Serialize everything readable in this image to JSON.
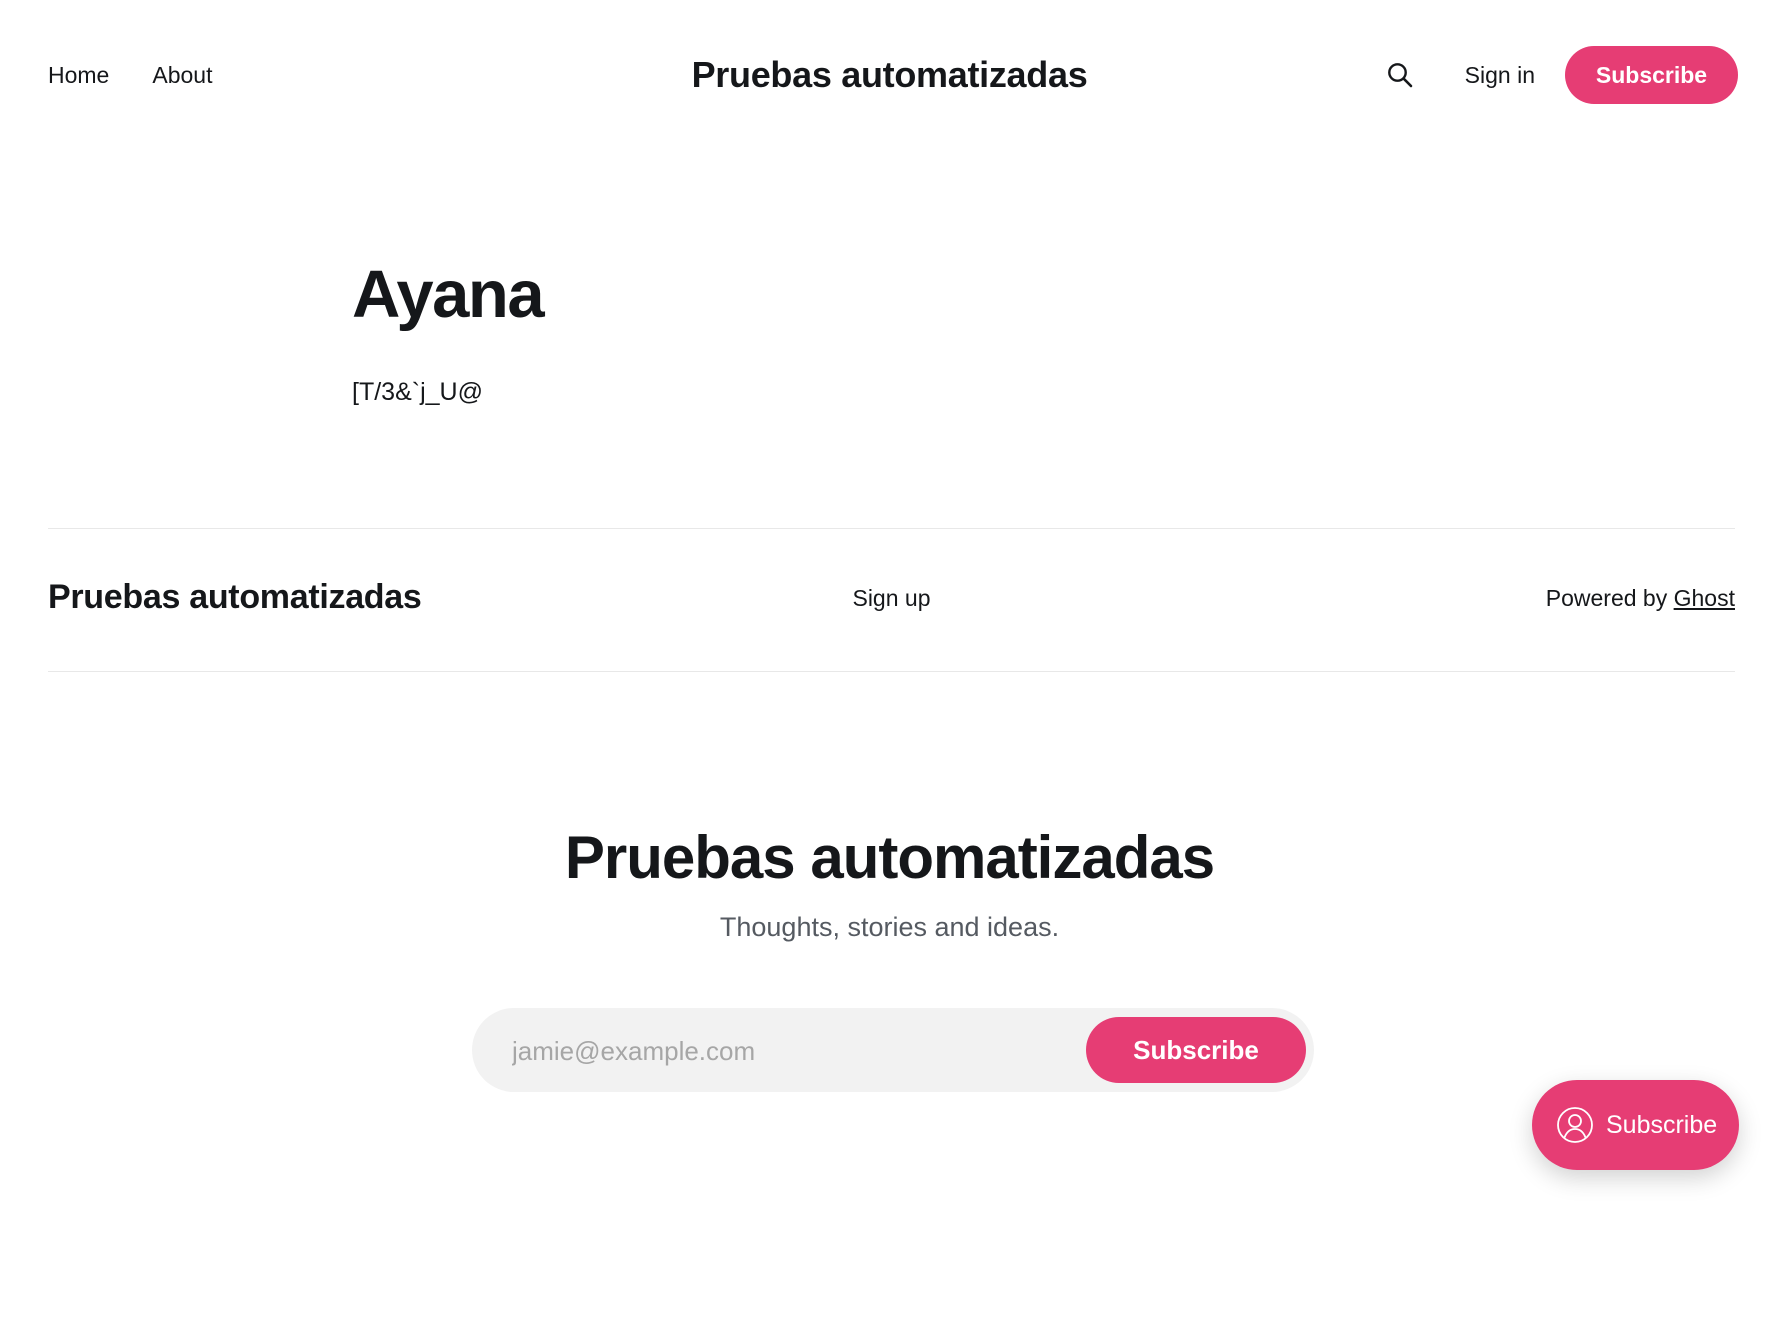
{
  "colors": {
    "accent": "#e63d74",
    "text": "#15171a",
    "muted": "#555a61",
    "input_bg": "#f2f2f2",
    "divider": "#e8e8e8"
  },
  "header": {
    "nav": [
      {
        "label": "Home"
      },
      {
        "label": "About"
      }
    ],
    "site_title": "Pruebas automatizadas",
    "search_icon": "search-icon",
    "signin_label": "Sign in",
    "subscribe_label": "Subscribe"
  },
  "author": {
    "name": "Ayana",
    "bio": "[T/3&`j_U@"
  },
  "footer": {
    "site_title": "Pruebas automatizadas",
    "signup_label": "Sign up",
    "powered_prefix": "Powered by ",
    "powered_link": "Ghost"
  },
  "cta": {
    "title": "Pruebas automatizadas",
    "description": "Thoughts, stories and ideas.",
    "email_placeholder": "jamie@example.com",
    "email_value": "",
    "submit_label": "Subscribe"
  },
  "portal": {
    "icon": "user-circle-icon",
    "label": "Subscribe"
  }
}
